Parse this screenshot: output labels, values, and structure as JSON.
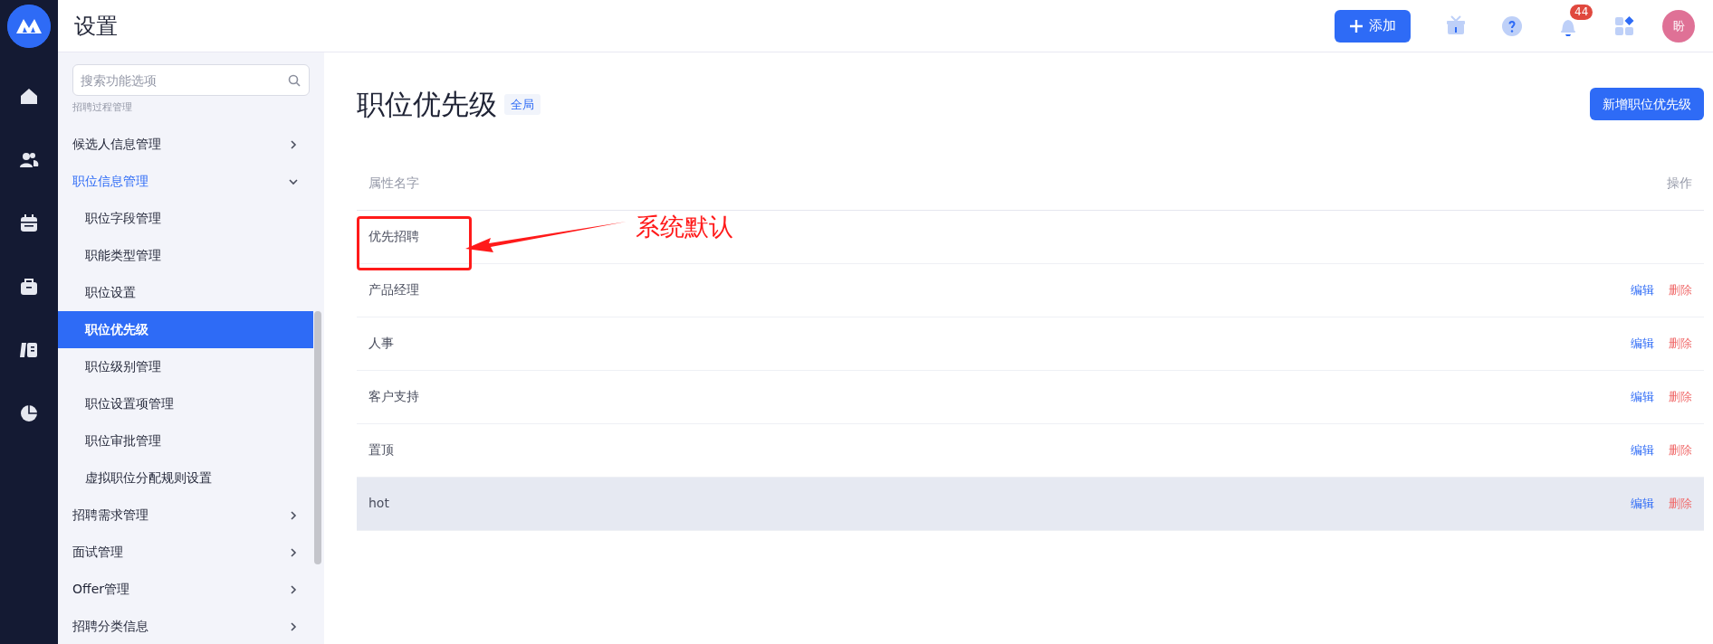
{
  "header": {
    "title": "设置",
    "add_button": "添加",
    "notification_count": "44",
    "avatar": "盼"
  },
  "rail": [
    {
      "kind": "home",
      "selected": false
    },
    {
      "kind": "people",
      "selected": false
    },
    {
      "kind": "calendar",
      "selected": false
    },
    {
      "kind": "briefcase",
      "selected": false
    },
    {
      "kind": "book",
      "selected": false
    },
    {
      "kind": "chart",
      "selected": false
    }
  ],
  "sidebar": {
    "search": {
      "placeholder": "搜索功能选项"
    },
    "section_label": "招聘过程管理",
    "items": [
      {
        "label": "候选人信息管理",
        "expanded": false,
        "selected": false
      },
      {
        "label": "职位信息管理",
        "expanded": true,
        "selected": false,
        "children": [
          {
            "label": "职位字段管理",
            "selected": false
          },
          {
            "label": "职能类型管理",
            "selected": false
          },
          {
            "label": "职位设置",
            "selected": false
          },
          {
            "label": "职位优先级",
            "selected": true
          },
          {
            "label": "职位级别管理",
            "selected": false
          },
          {
            "label": "职位设置项管理",
            "selected": false
          },
          {
            "label": "职位审批管理",
            "selected": false
          },
          {
            "label": "虚拟职位分配规则设置",
            "selected": false
          }
        ]
      },
      {
        "label": "招聘需求管理",
        "expanded": false,
        "selected": false
      },
      {
        "label": "面试管理",
        "expanded": false,
        "selected": false
      },
      {
        "label": "Offer管理",
        "expanded": false,
        "selected": false
      },
      {
        "label": "招聘分类信息",
        "expanded": false,
        "selected": false
      }
    ]
  },
  "page": {
    "title": "职位优先级",
    "scope_tag": "全局",
    "new_button": "新增职位优先级",
    "table": {
      "columns": [
        "属性名字",
        "操作"
      ],
      "rows": [
        {
          "name": "优先招聘",
          "actions": [],
          "highlighted": false,
          "annotated": true
        },
        {
          "name": "产品经理",
          "actions": [
            "编辑",
            "删除"
          ],
          "highlighted": false,
          "annotated": false
        },
        {
          "name": "人事",
          "actions": [
            "编辑",
            "删除"
          ],
          "highlighted": false,
          "annotated": false
        },
        {
          "name": "客户支持",
          "actions": [
            "编辑",
            "删除"
          ],
          "highlighted": false,
          "annotated": false
        },
        {
          "name": "置顶",
          "actions": [
            "编辑",
            "删除"
          ],
          "highlighted": false,
          "annotated": false
        },
        {
          "name": "hot",
          "actions": [
            "编辑",
            "删除"
          ],
          "highlighted": true,
          "annotated": false
        }
      ]
    }
  },
  "annotation": {
    "text": "系统默认"
  }
}
